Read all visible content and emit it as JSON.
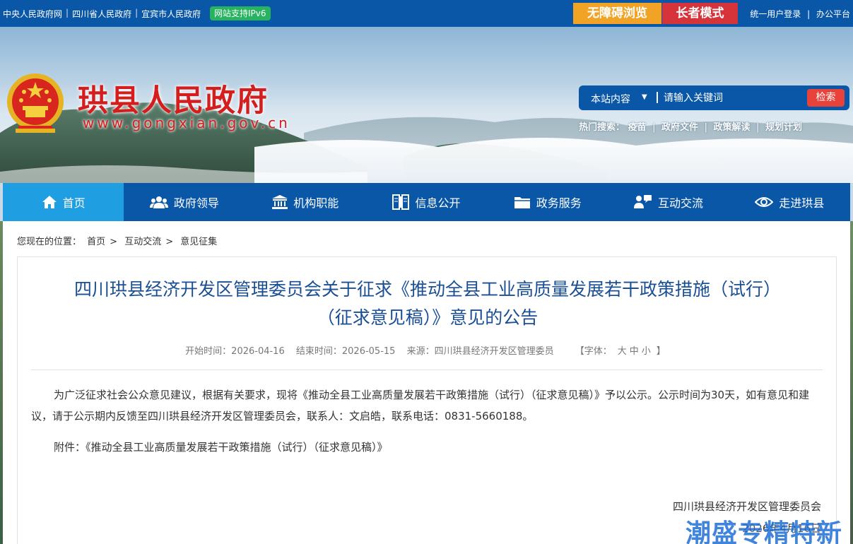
{
  "topbar": {
    "links": [
      "中央人民政府网",
      "四川省人民政府",
      "宜宾市人民政府"
    ],
    "ipv6_badge": "网站支持IPv6",
    "accessibility_button": "无障碍浏览",
    "elder_mode_button": "长者模式",
    "right_links": [
      "统一用户登录",
      "办公平台"
    ],
    "colors": {
      "bar": "#0a57a7",
      "accessibility": "#f0a324",
      "elder": "#d6343a",
      "ipv6": "#27b35f"
    }
  },
  "header": {
    "site_title": "珙县人民政府",
    "site_url": "www.gongxian.gov.cn",
    "emblem_icon": "national-emblem-icon"
  },
  "search": {
    "scope": "本站内容",
    "placeholder": "请输入关键词",
    "button": "检索",
    "hot_label": "热门搜索：",
    "hot_terms": [
      "疫苗",
      "政府文件",
      "政策解读",
      "规划计划"
    ]
  },
  "nav": {
    "items": [
      {
        "label": "首页",
        "icon": "home-icon",
        "active": true
      },
      {
        "label": "政府领导",
        "icon": "people-icon"
      },
      {
        "label": "机构职能",
        "icon": "institution-icon"
      },
      {
        "label": "信息公开",
        "icon": "book-icon"
      },
      {
        "label": "政务服务",
        "icon": "folder-icon"
      },
      {
        "label": "互动交流",
        "icon": "interaction-icon"
      },
      {
        "label": "走进珙县",
        "icon": "eye-icon"
      }
    ],
    "colors": {
      "bar": "#0a57a7",
      "active": "#1f9fe2"
    }
  },
  "breadcrumb": {
    "label": "您现在的位置：",
    "items": [
      "首页",
      "互动交流",
      "意见征集"
    ],
    "separator": ">"
  },
  "article": {
    "title_line1": "四川珙县经济开发区管理委员会关于征求《推动全县工业高质量发展若干政策措施（试行）",
    "title_line2": "（征求意见稿）》意见的公告",
    "meta": {
      "start": "开始时间：2026-04-16",
      "end": "结束时间：2026-05-15",
      "source": "来源：四川珙县经济开发区管理委员",
      "font_label_open": "【字体：",
      "font_large": "大",
      "font_medium": "中",
      "font_small": "小",
      "font_label_close": "】"
    },
    "paragraph1": "为广泛征求社会公众意见建议，根据有关要求，现将《推动全县工业高质量发展若干政策措施（试行）（征求意见稿）》予以公示。公示时间为30天，如有意见和建议，请于公示期内反馈至四川珙县经济开发区管理委员会，联系人：文启皓，联系电话：0831-5660188。",
    "paragraph2": "附件：《推动全县工业高质量发展若干政策措施（试行）（征求意见稿）》",
    "sign_org": "四川珙县经济开发区管理委员会",
    "sign_date": "2026年4月16日",
    "title_color": "#1a4f94"
  },
  "watermark": "潮盛专精特新"
}
